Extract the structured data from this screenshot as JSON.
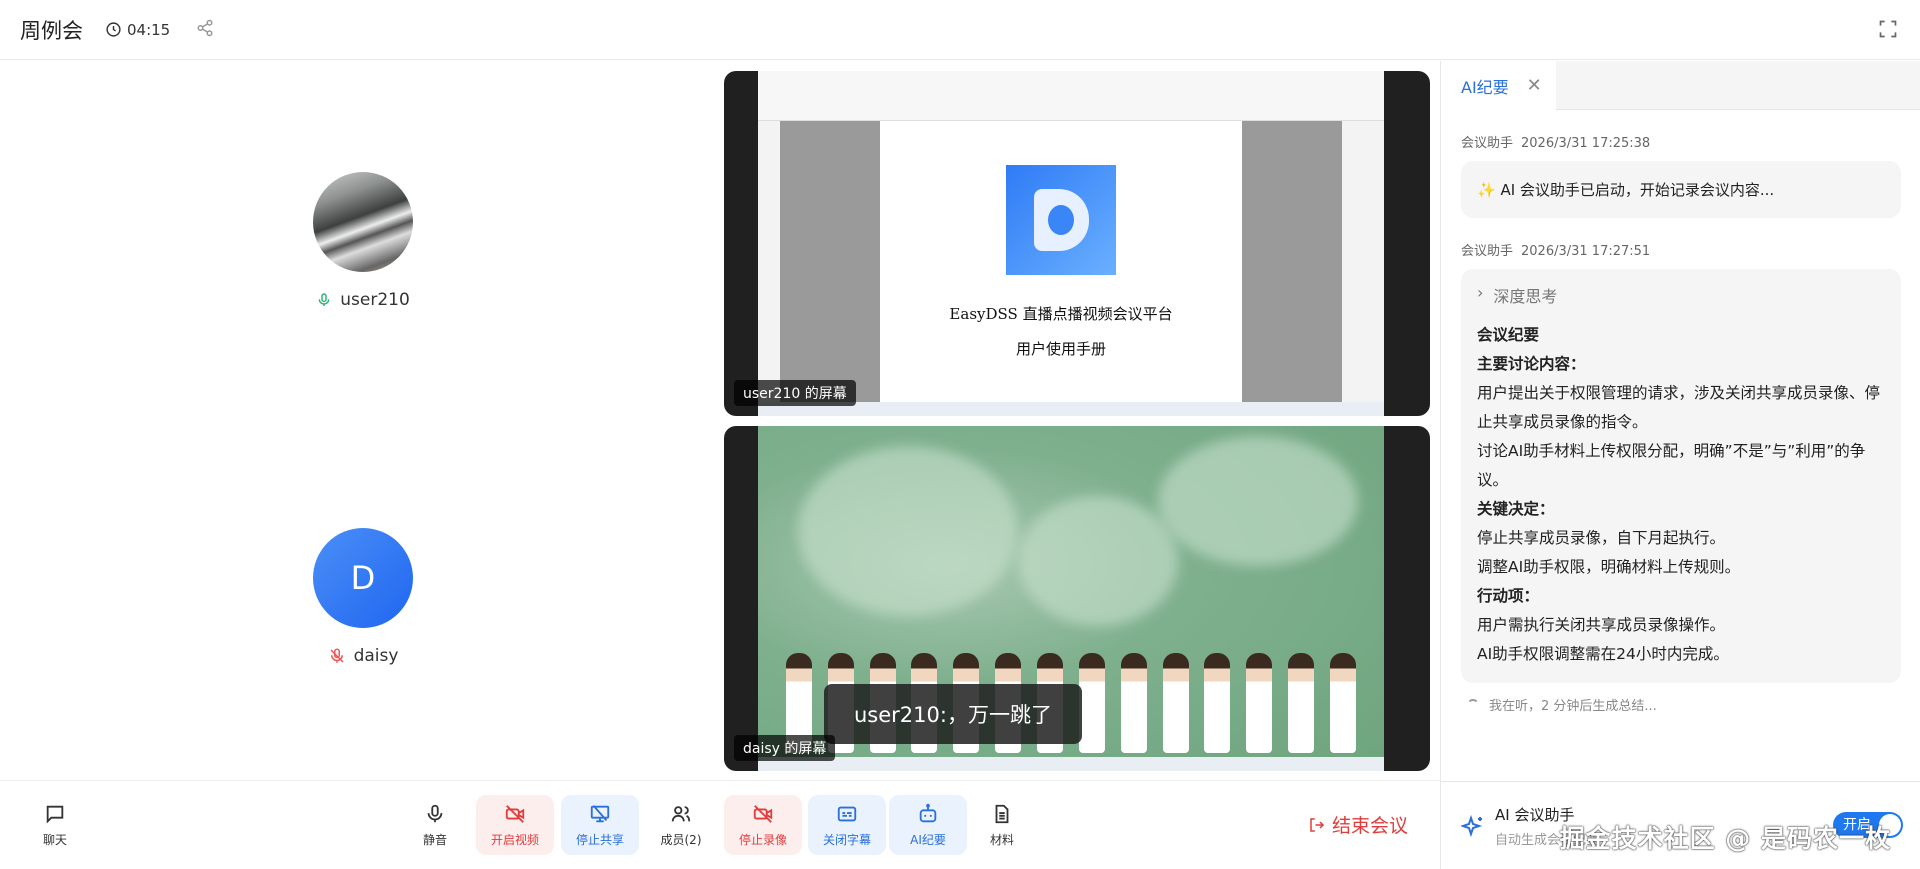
{
  "header": {
    "title": "周例会",
    "timer": "04:15"
  },
  "participants": [
    {
      "name": "user210",
      "mic": "on"
    },
    {
      "name": "daisy",
      "avatar_letter": "D",
      "mic": "muted"
    }
  ],
  "videos": [
    {
      "label": "user210 的屏幕",
      "doc_title": "EasyDSS 直播点播视频会议平台",
      "doc_subtitle": "用户使用手册"
    },
    {
      "label": "daisy 的屏幕",
      "subtitle": "user210:，万一跳了"
    }
  ],
  "toolbar": {
    "chat": "聊天",
    "mute": "静音",
    "start_video": "开启视频",
    "stop_share": "停止共享",
    "members": "成员(2)",
    "stop_record": "停止录像",
    "close_caption": "关闭字幕",
    "ai_summary": "AI纪要",
    "materials": "材料",
    "end_meeting": "结束会议"
  },
  "panel": {
    "tab": "AI纪要",
    "messages": [
      {
        "sender": "会议助手",
        "time": "2026/3/31 17:25:38",
        "text": "✨ AI 会议助手已启动，开始记录会议内容..."
      },
      {
        "sender": "会议助手",
        "time": "2026/3/31 17:27:51",
        "think": "深度思考",
        "lines": [
          {
            "t": "会议纪要",
            "b": true
          },
          {
            "t": "主要讨论内容：",
            "b": true
          },
          {
            "t": "用户提出关于权限管理的请求，涉及关闭共享成员录像、停止共享成员录像的指令。"
          },
          {
            "t": "讨论AI助手材料上传权限分配，明确”不是”与”利用”的争议。"
          },
          {
            "t": "关键决定：",
            "b": true
          },
          {
            "t": "停止共享成员录像，自下月起执行。"
          },
          {
            "t": "调整AI助手权限，明确材料上传规则。"
          },
          {
            "t": "行动项：",
            "b": true
          },
          {
            "t": "用户需执行关闭共享成员录像操作。"
          },
          {
            "t": "AI助手权限调整需在24小时内完成。"
          }
        ]
      }
    ],
    "listening": "我在听，2 分钟后生成总结...",
    "assistant_title": "AI 会议助手",
    "assistant_sub": "自动生成会议纪要",
    "toggle_label": "开启",
    "watermark": "掘金技术社区 @ 是码农一枚"
  }
}
